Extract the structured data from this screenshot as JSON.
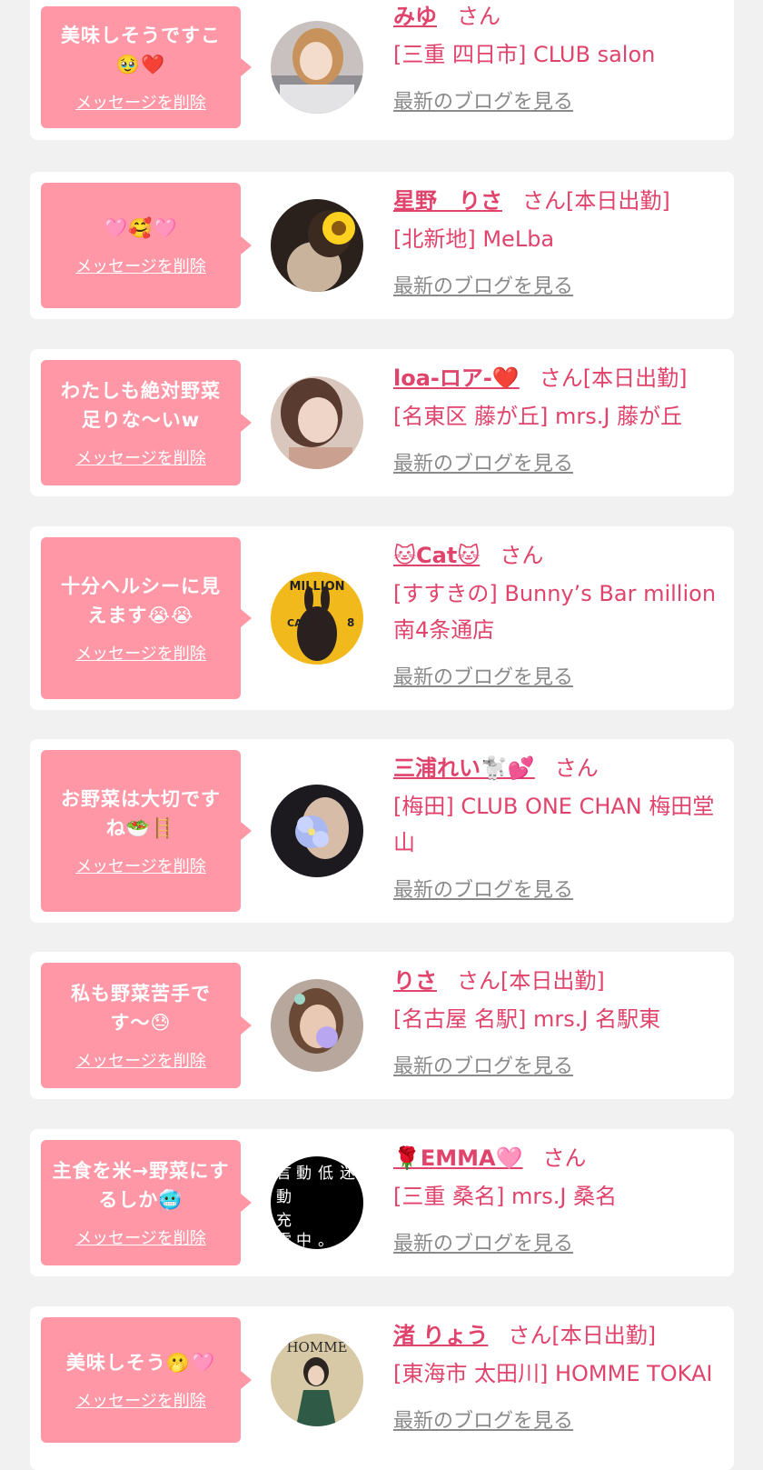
{
  "delete_label": "メッセージを削除",
  "blog_label": "最新のブログを見る",
  "san_label": "さん",
  "on_duty_label": "[本日出勤]",
  "items": [
    {
      "msg": "美味しそうですこ🥹❤️",
      "name": "みゆ",
      "on_duty": "",
      "shop": "[三重 四日市] CLUB salon"
    },
    {
      "msg": "🩷🥰🩷",
      "name": "星野　りさ",
      "on_duty": "[本日出勤]",
      "shop": "[北新地] MeLba"
    },
    {
      "msg": "わたしも絶対野菜足りな〜いw",
      "name": "loa-ロア-❤️",
      "on_duty": "[本日出勤]",
      "shop": "[名東区 藤が丘] mrs.J 藤が丘"
    },
    {
      "msg": "十分ヘルシーに見えます😭😭",
      "name": "🐱Cat🐱",
      "on_duty": "",
      "shop": "[すすきの] Bunny’s Bar million 南4条通店"
    },
    {
      "msg": "お野菜は大切ですね🥗🪜",
      "name": "三浦れい🐩💕",
      "on_duty": "",
      "shop": "[梅田] CLUB ONE CHAN 梅田堂山"
    },
    {
      "msg": "私も野菜苦手です〜😓",
      "name": "りさ",
      "on_duty": "[本日出勤]",
      "shop": "[名古屋 名駅] mrs.J 名駅東"
    },
    {
      "msg": "主食を米→野菜にするしか🥶",
      "name": "🌹EMMA🩷",
      "on_duty": "",
      "shop": "[三重 桑名] mrs.J 桑名"
    },
    {
      "msg": "美味しそう🫢🩷",
      "name": "渚 りょう",
      "on_duty": "[本日出勤]",
      "shop": "[東海市 太田川] HOMME TOKAI"
    }
  ],
  "avatar_text": {
    "cat_top": "MILLION",
    "cat_label": "CAT",
    "cat_num": "8",
    "homme": "HOMME"
  },
  "colors": {
    "accent": "#e0436b",
    "bubble": "#ff97a6",
    "link_gray": "#8a8a8a"
  }
}
